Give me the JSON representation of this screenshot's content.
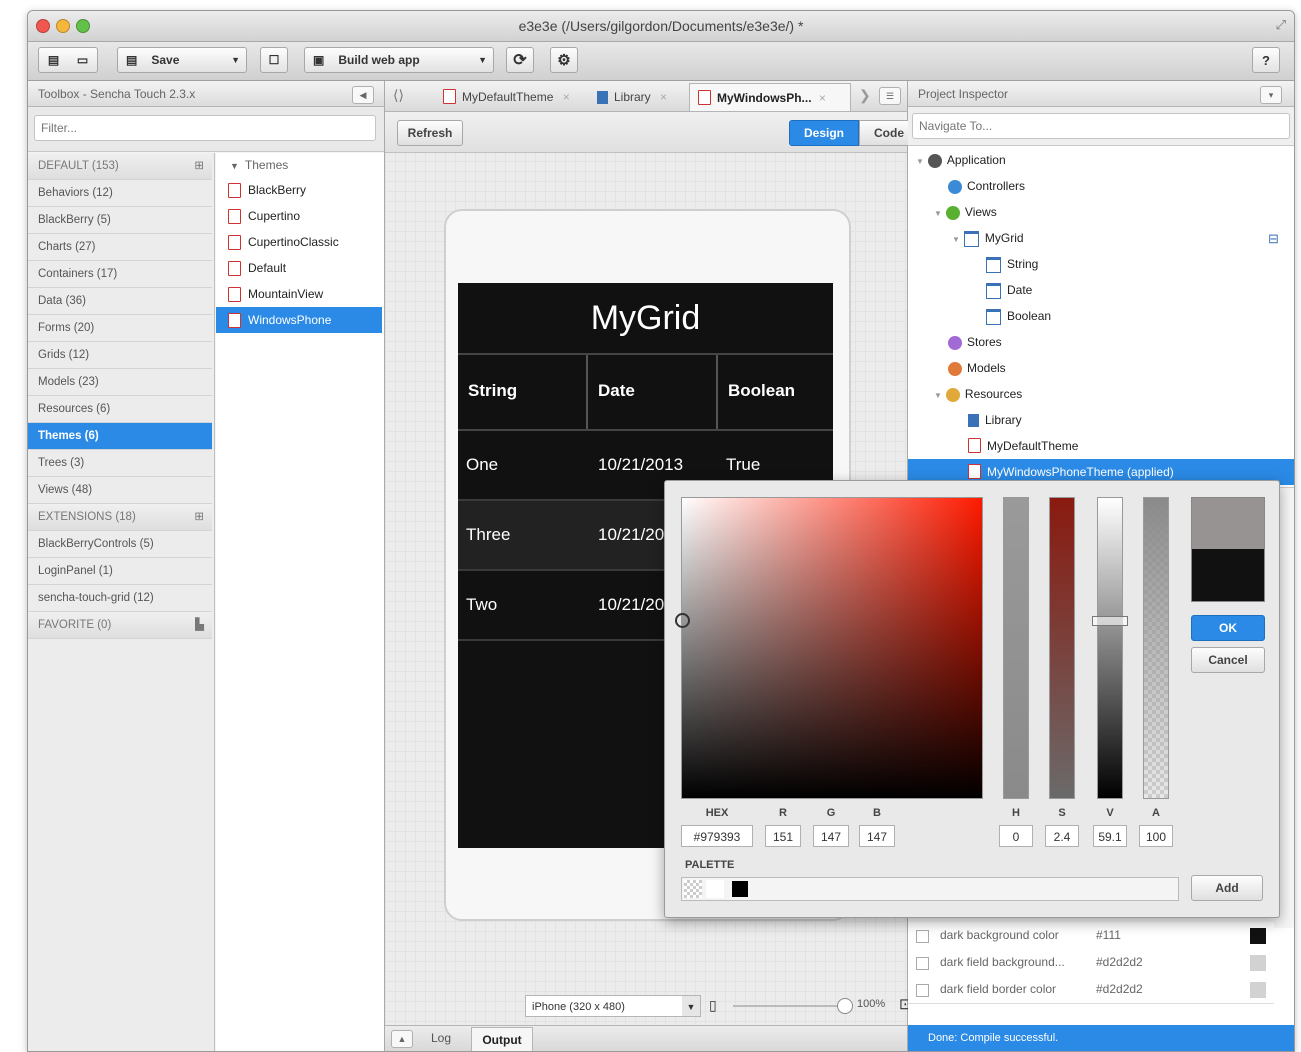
{
  "window": {
    "title": "e3e3e (/Users/gilgordon/Documents/e3e3e/) *"
  },
  "toolbar": {
    "save_label": "Save",
    "build_label": "Build web app"
  },
  "toolbox": {
    "header": "Toolbox - Sencha Touch 2.3.x",
    "filter_placeholder": "Filter...",
    "categories": [
      {
        "label": "DEFAULT (153)"
      },
      {
        "label": "Behaviors (12)"
      },
      {
        "label": "BlackBerry (5)"
      },
      {
        "label": "Charts (27)"
      },
      {
        "label": "Containers (17)"
      },
      {
        "label": "Data (36)"
      },
      {
        "label": "Forms (20)"
      },
      {
        "label": "Grids (12)"
      },
      {
        "label": "Models (23)"
      },
      {
        "label": "Resources (6)"
      },
      {
        "label": "Themes (6)"
      },
      {
        "label": "Trees (3)"
      },
      {
        "label": "Views (48)"
      },
      {
        "label": "EXTENSIONS (18)"
      },
      {
        "label": "BlackBerryControls (5)"
      },
      {
        "label": "LoginPanel (1)"
      },
      {
        "label": "sencha-touch-grid (12)"
      },
      {
        "label": "FAVORITE (0)"
      }
    ],
    "themes_header": "Themes",
    "themes": [
      "BlackBerry",
      "Cupertino",
      "CupertinoClassic",
      "Default",
      "MountainView",
      "WindowsPhone"
    ]
  },
  "editor": {
    "tabs": [
      "MyDefaultTheme",
      "Library",
      "MyWindowsPh..."
    ],
    "refresh_label": "Refresh",
    "design_label": "Design",
    "code_label": "Code",
    "grid": {
      "title": "MyGrid",
      "columns": [
        "String",
        "Date",
        "Boolean"
      ],
      "rows": [
        [
          "One",
          "10/21/2013",
          "True"
        ],
        [
          "Three",
          "10/21/20",
          ""
        ],
        [
          "Two",
          "10/21/20",
          ""
        ]
      ]
    },
    "device_select": "iPhone (320 x 480)",
    "zoom": "100%",
    "bottom_tabs": [
      "Log",
      "Output"
    ]
  },
  "inspector": {
    "header": "Project Inspector",
    "navigate_placeholder": "Navigate To...",
    "tree": [
      {
        "label": "Application"
      },
      {
        "label": "Controllers"
      },
      {
        "label": "Views"
      },
      {
        "label": "MyGrid"
      },
      {
        "label": "String"
      },
      {
        "label": "Date"
      },
      {
        "label": "Boolean"
      },
      {
        "label": "Stores"
      },
      {
        "label": "Models"
      },
      {
        "label": "Resources"
      },
      {
        "label": "Library"
      },
      {
        "label": "MyDefaultTheme"
      },
      {
        "label": "MyWindowsPhoneTheme (applied)"
      }
    ]
  },
  "properties": [
    {
      "name": "dark background color",
      "value": "#111",
      "swatch": "#111111"
    },
    {
      "name": "dark field background...",
      "value": "#d2d2d2",
      "swatch": "#d2d2d2"
    },
    {
      "name": "dark field border color",
      "value": "#d2d2d2",
      "swatch": "#d2d2d2"
    }
  ],
  "status": {
    "text": "Done: Compile successful."
  },
  "color_picker": {
    "hex_label": "HEX",
    "r_label": "R",
    "g_label": "G",
    "b_label": "B",
    "h_label": "H",
    "s_label": "S",
    "v_label": "V",
    "a_label": "A",
    "hex": "#979393",
    "r": "151",
    "g": "147",
    "b": "147",
    "h": "0",
    "s": "2.4",
    "v": "59.1",
    "a": "100",
    "palette_label": "PALETTE",
    "ok_label": "OK",
    "cancel_label": "Cancel",
    "add_label": "Add",
    "new_color": "#979393",
    "old_color": "#111111"
  },
  "colors": {
    "accent": "#2a8ae6",
    "grid_bg": "#111111"
  },
  "icons": [
    "new-file-icon",
    "open-folder-icon",
    "save-icon",
    "layout-icon",
    "build-icon",
    "refresh-icon",
    "gear-icon",
    "help-icon",
    "file-icon",
    "library-icon",
    "phone-icon",
    "zoom-fit-icon"
  ]
}
